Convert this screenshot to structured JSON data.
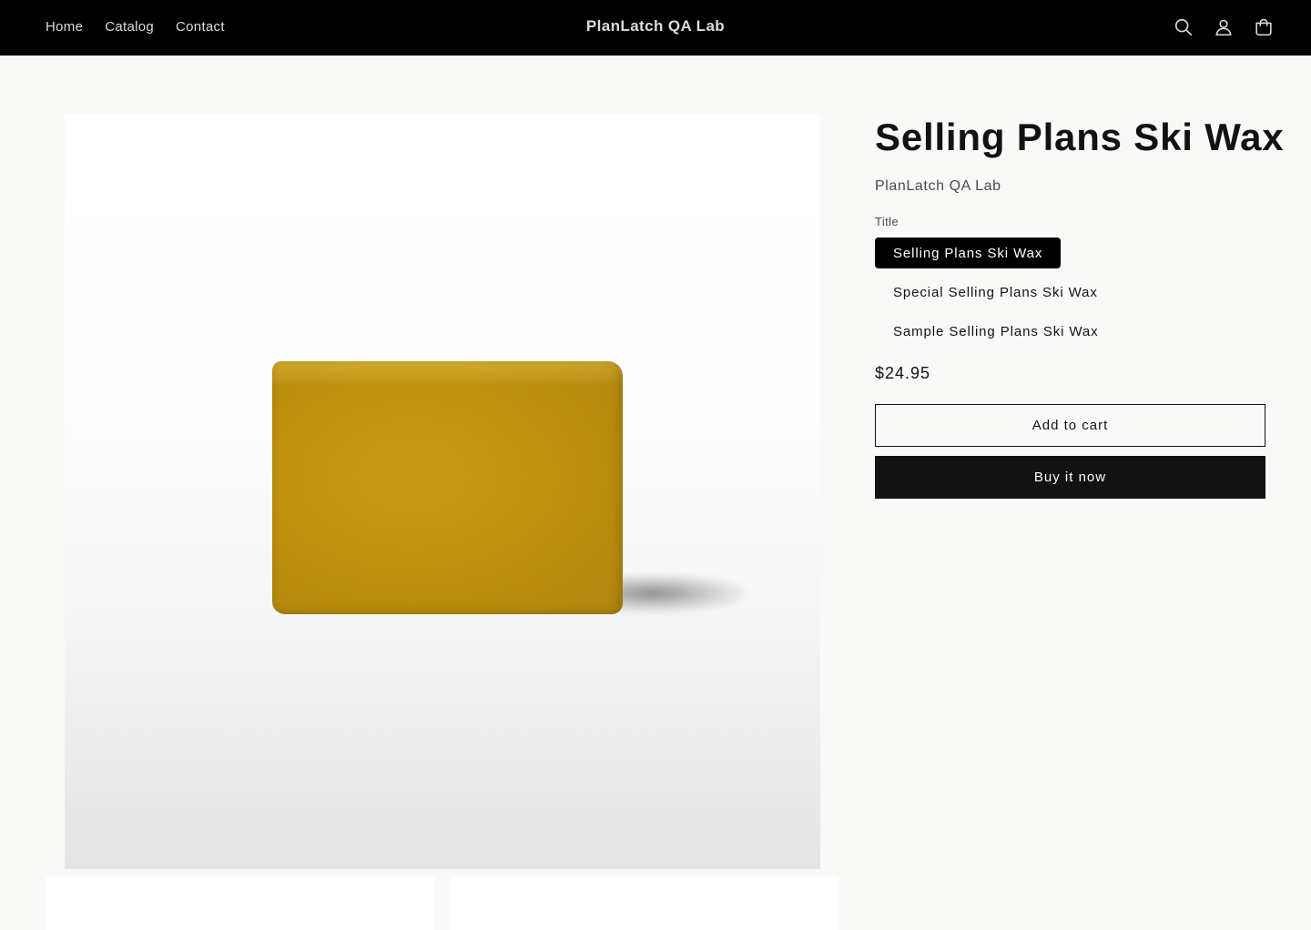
{
  "header": {
    "nav": [
      "Home",
      "Catalog",
      "Contact"
    ],
    "brand": "PlanLatch QA Lab",
    "icons": [
      "search-icon",
      "account-icon",
      "cart-icon"
    ]
  },
  "product": {
    "title": "Selling Plans Ski Wax",
    "vendor": "PlanLatch QA Lab",
    "option_label": "Title",
    "variants": [
      "Selling Plans Ski Wax",
      "Special Selling Plans Ski Wax",
      "Sample Selling Plans Ski Wax"
    ],
    "selected_variant": "Selling Plans Ski Wax",
    "price": "$24.95",
    "add_to_cart_label": "Add to cart",
    "buy_now_label": "Buy it now"
  },
  "colors": {
    "header_bg": "#000000",
    "page_bg": "#f9f9f7",
    "button_dark": "#121212",
    "product_wax": "#c0930f"
  }
}
